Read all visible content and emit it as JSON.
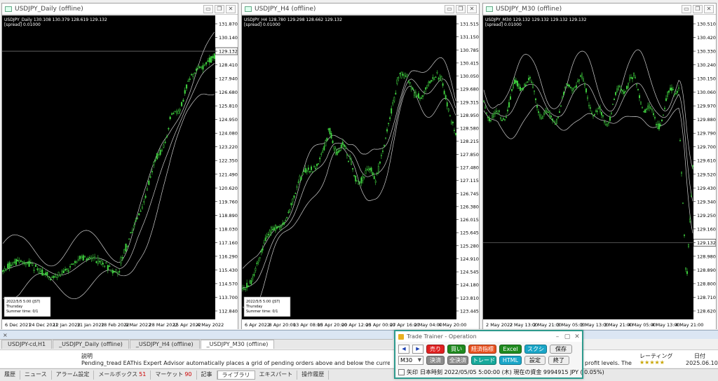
{
  "charts": [
    {
      "title": "USDJPY_Daily (offline)",
      "header_lines": [
        "USDJPY_Daily  130.108 130.379 128.619 129.132"
      ],
      "overlay_lines": [
        "[spread] 0.01000"
      ],
      "yticks": [
        "131.870",
        "130.140",
        "129.132",
        "128.410",
        "127.940",
        "126.680",
        "125.810",
        "124.950",
        "124.080",
        "123.220",
        "122.350",
        "121.490",
        "120.620",
        "119.760",
        "118.890",
        "118.030",
        "117.160",
        "116.290",
        "115.430",
        "114.570",
        "113.700",
        "112.840"
      ],
      "current_price": "129.132",
      "xticks": [
        "6 Dec 2021",
        "24 Dec 2021",
        "12 Jan 2022",
        "31 Jan 2022",
        "18 Feb 2022",
        "9 Mar 2022",
        "28 Mar 2022",
        "15 Apr 2022",
        "4 May 2022"
      ],
      "info_box": [
        "2022/5/5 5:00 (JST)",
        "Thursday",
        "Summer time:   0/1"
      ]
    },
    {
      "title": "USDJPY_H4 (offline)",
      "header_lines": [
        "USDJPY_H4  128.780 129.298 128.662 129.132"
      ],
      "overlay_lines": [
        "[spread] 0.01000"
      ],
      "yticks": [
        "131.515",
        "131.150",
        "130.785",
        "130.415",
        "130.050",
        "129.680",
        "129.315",
        "128.950",
        "128.580",
        "128.215",
        "127.850",
        "127.480",
        "127.115",
        "126.745",
        "126.380",
        "126.015",
        "125.645",
        "125.280",
        "124.910",
        "124.545",
        "124.180",
        "123.810",
        "123.445"
      ],
      "current_price": "129.132",
      "xticks": [
        "6 Apr 2022",
        "8 Apr 20:00",
        "13 Apr 08:00",
        "15 Apr 20:00",
        "20 Apr 12:00",
        "25 Apr 00:00",
        "27 Apr 16:00",
        "2 May 04:00",
        "4 May 20:00"
      ],
      "info_box": [
        "2022/5/5 5:00 (JST)",
        "Thursday",
        "Summer time:   0/1"
      ]
    },
    {
      "title": "USDJPY_M30 (offline)",
      "header_lines": [
        "USDJPY_M30  129.132 129.132 129.132 129.132"
      ],
      "overlay_lines": [
        "[spread] 0.01000"
      ],
      "yticks": [
        "130.510",
        "130.420",
        "130.330",
        "130.240",
        "130.150",
        "130.060",
        "129.970",
        "129.880",
        "129.790",
        "129.700",
        "129.610",
        "129.520",
        "129.430",
        "129.340",
        "129.250",
        "129.160",
        "129.132",
        "128.980",
        "128.890",
        "128.800",
        "128.710",
        "128.620"
      ],
      "current_price": "129.132",
      "xticks": [
        "2 May 2022",
        "2 May 13:00",
        "2 May 21:00",
        "3 May 05:00",
        "3 May 13:00",
        "3 May 21:00",
        "4 May 05:00",
        "4 May 13:00",
        "4 May 21:00"
      ],
      "info_box": []
    }
  ],
  "toolbox": {
    "label": "",
    "close": "×"
  },
  "chart_tabs": [
    "USDJPY-cd,H1",
    "_USDJPY_Daily (offline)",
    "_USDJPY_H4 (offline)",
    "_USDJPY_M30 (offline)"
  ],
  "description": {
    "header": "説明",
    "text": "Pending_tread EAThis Expert Advisor automatically places a grid of pending orders above and below the current market price. It supports both",
    "text_tail": "profit levels. The",
    "rating_label": "レーティング",
    "date_label": "日付",
    "date": "2025.06.10",
    "stars": "★★★★★"
  },
  "bottom_tabs": [
    {
      "label": "履歴"
    },
    {
      "label": "ニュース"
    },
    {
      "label": "アラーム設定"
    },
    {
      "label": "メールボックス",
      "badge": "51"
    },
    {
      "label": "マーケット",
      "badge": "90"
    },
    {
      "label": "記事"
    },
    {
      "label": "ライブラリ",
      "active": true
    },
    {
      "label": "エキスパート"
    },
    {
      "label": "操作履歴"
    }
  ],
  "trainer": {
    "title": "Trade Trainer - Operation",
    "nav_prev": "◀",
    "nav_next": "▶",
    "buttons_row1": [
      {
        "label": "売り",
        "color": "#e02020"
      },
      {
        "label": "買い",
        "color": "#1f8a1f"
      },
      {
        "label": "経済指標",
        "color": "#e8501e"
      },
      {
        "label": "Excel",
        "color": "#1f8a1f"
      },
      {
        "label": "スクショ",
        "color": "#1aa6c8"
      },
      {
        "label": "保存",
        "color": "#eeeeee"
      }
    ],
    "timeframe": "M30",
    "buttons_row2": [
      {
        "label": "決済",
        "color": "#8c8c8c"
      },
      {
        "label": "全決済",
        "color": "#8c8c8c"
      },
      {
        "label": "トレード",
        "color": "#16a89a"
      },
      {
        "label": "HTML",
        "color": "#1aa6c8"
      },
      {
        "label": "設定",
        "color": "#eeeeee"
      },
      {
        "label": "終了",
        "color": "#eeeeee"
      }
    ],
    "checkbox_label": "矢印",
    "status_text": "日本時刻 2022/05/05 5:00:00 (木)    現在の資金 9994915 JPY ( 0.05%)"
  }
}
